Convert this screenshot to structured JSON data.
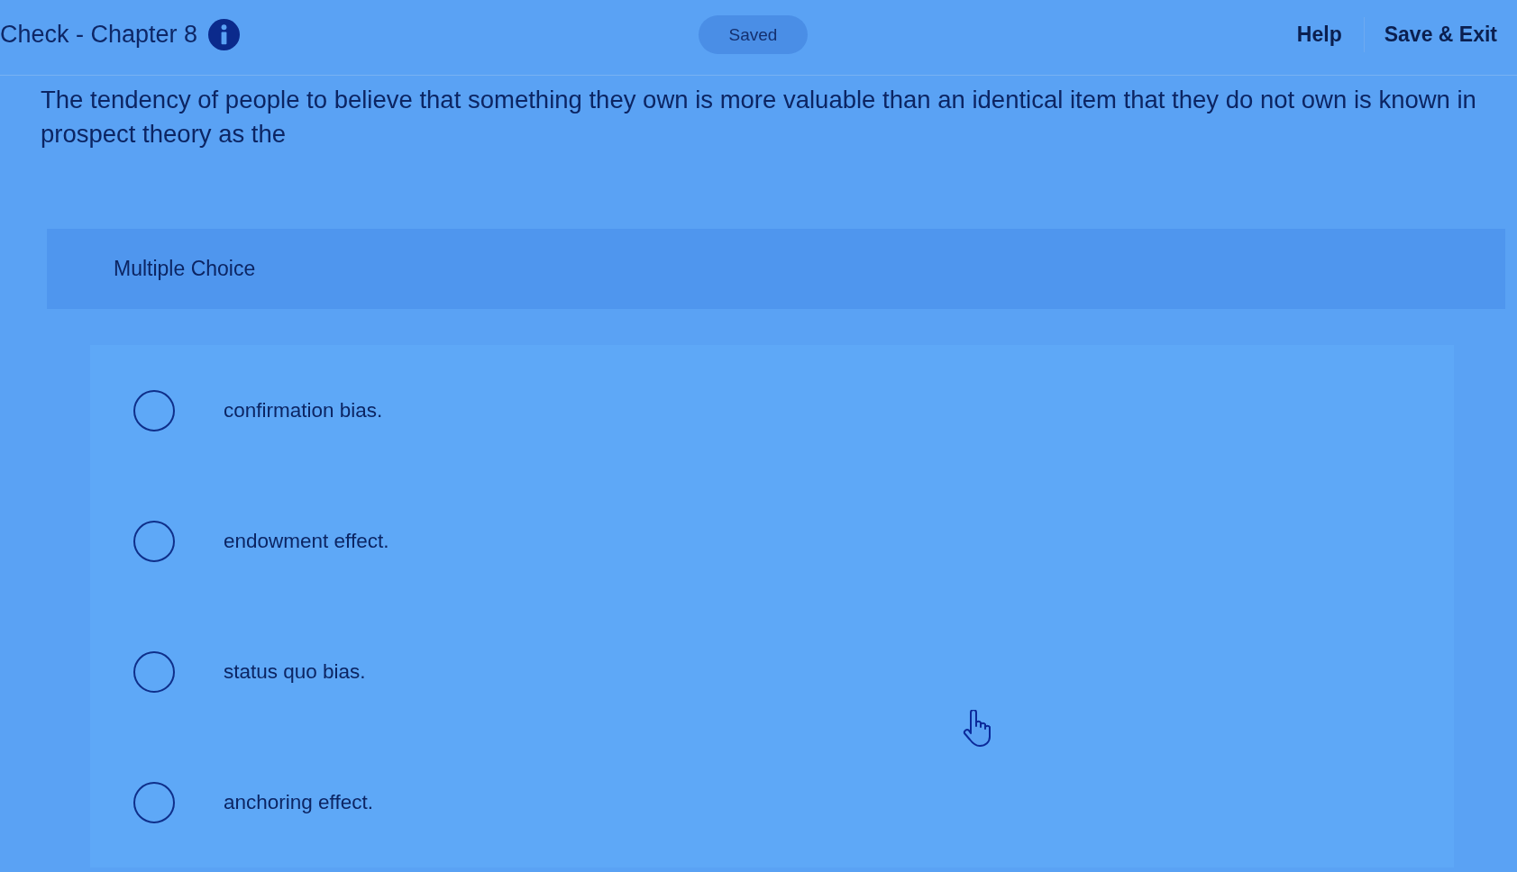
{
  "header": {
    "title": "Check - Chapter 8",
    "status": "Saved",
    "links": [
      "Help",
      "Save & Exit"
    ]
  },
  "question": {
    "prompt": "The tendency of people to believe that something they own is more valuable than an identical item that they do not own is known in prospect theory as the",
    "type_label": "Multiple Choice",
    "choices": [
      {
        "label": "confirmation bias.",
        "selected": false
      },
      {
        "label": "endowment effect.",
        "selected": false
      },
      {
        "label": "status quo bias.",
        "selected": false
      },
      {
        "label": "anchoring effect.",
        "selected": false
      }
    ]
  }
}
